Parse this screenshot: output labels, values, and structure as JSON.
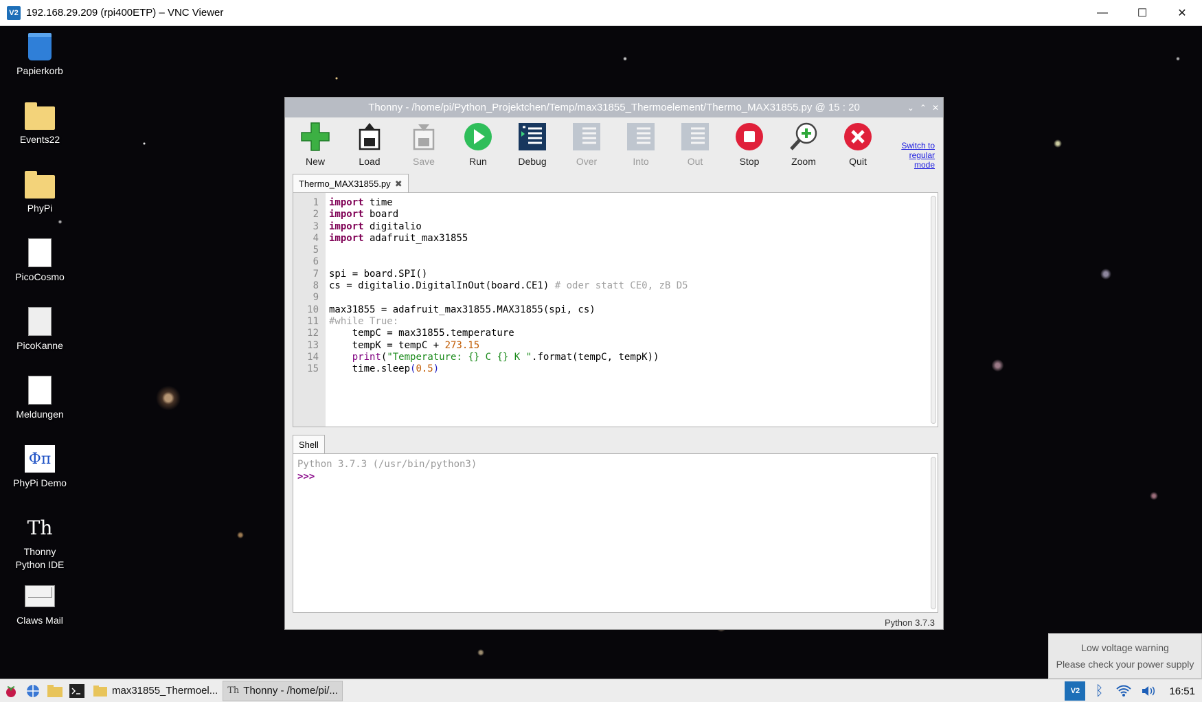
{
  "vnc": {
    "title": "192.168.29.209 (rpi400ETP) – VNC Viewer",
    "minimize": "—",
    "maximize": "☐",
    "close": "✕"
  },
  "desktop_icons": [
    {
      "label": "Papierkorb",
      "icon": "trash-icon"
    },
    {
      "label": "Events22",
      "icon": "folder-icon"
    },
    {
      "label": "PhyPi",
      "icon": "folder-icon"
    },
    {
      "label": "PicoCosmo",
      "icon": "document-icon"
    },
    {
      "label": "PicoKanne",
      "icon": "kettle-icon"
    },
    {
      "label": "Meldungen",
      "icon": "document-icon"
    },
    {
      "label": "PhyPi Demo",
      "icon": "phypi-icon"
    },
    {
      "label": "Thonny Python IDE",
      "icon": "thonny-icon"
    },
    {
      "label": "Claws Mail",
      "icon": "mail-icon"
    }
  ],
  "thonny": {
    "title": "Thonny  -  /home/pi/Python_Projektchen/Temp/max31855_Thermoelement/Thermo_MAX31855.py  @  15 : 20",
    "toolbar": {
      "new": "New",
      "load": "Load",
      "save": "Save",
      "run": "Run",
      "debug": "Debug",
      "over": "Over",
      "into": "Into",
      "out": "Out",
      "stop": "Stop",
      "zoom": "Zoom",
      "quit": "Quit"
    },
    "switch_mode": "Switch to regular mode",
    "editor_tab": "Thermo_MAX31855.py",
    "line_numbers": "1\n2\n3\n4\n5\n6\n7\n8\n9\n10\n11\n12\n13\n14\n15",
    "shell_tab": "Shell",
    "shell_banner": "Python 3.7.3 (/usr/bin/python3)",
    "shell_prompt": ">>>",
    "status": "Python 3.7.3",
    "colors": {
      "keyword": "#7f0055",
      "comment": "#a0a0a0",
      "string": "#1a8a1a",
      "number": "#c05a00"
    }
  },
  "code_lines": [
    "import time",
    "import board",
    "import digitalio",
    "import adafruit_max31855",
    "",
    "",
    "spi = board.SPI()",
    "cs = digitalio.DigitalInOut(board.CE1) # oder statt CE0, zB D5",
    "",
    "max31855 = adafruit_max31855.MAX31855(spi, cs)",
    "#while True:",
    "    tempC = max31855.temperature",
    "    tempK = tempC + 273.15",
    "    print(\"Temperature: {} C {} K \".format(tempC, tempK))",
    "    time.sleep(0.5)"
  ],
  "toast": {
    "line1": "Low voltage warning",
    "line2": "Please check your power supply"
  },
  "taskbar": {
    "task1": "max31855_Thermoel...",
    "task2": "Thonny  -  /home/pi/...",
    "clock": "16:51"
  }
}
